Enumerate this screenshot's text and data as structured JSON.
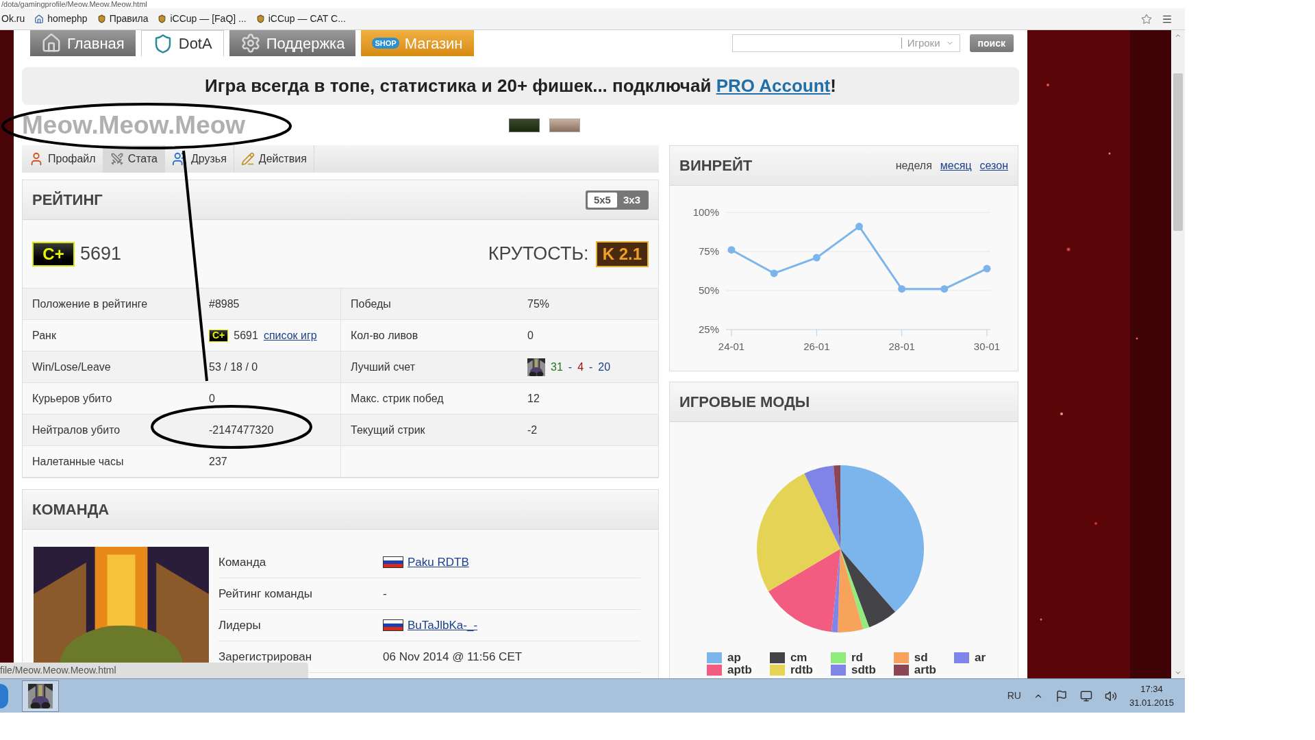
{
  "address_bar": {
    "url": "/dota/gamingprofile/Meow.Meow.Meow.html"
  },
  "bookmarks": [
    {
      "label": "Ok.ru",
      "kind": "ok"
    },
    {
      "label": "homephp",
      "kind": "home"
    },
    {
      "label": "Правила",
      "kind": "shield"
    },
    {
      "label": "iCCup — [FaQ] ...",
      "kind": "shield"
    },
    {
      "label": "iCCup — CAT C...",
      "kind": "shield"
    }
  ],
  "nav": {
    "tabs": [
      {
        "label": "Главная",
        "selected": false,
        "kind": "home"
      },
      {
        "label": "DotA",
        "selected": true,
        "kind": "dota"
      },
      {
        "label": "Поддержка",
        "selected": false,
        "kind": "support"
      },
      {
        "label": "Магазин",
        "selected": false,
        "kind": "shop",
        "badge": "SHOP"
      }
    ],
    "search": {
      "scope": "Игроки",
      "button": "поиск"
    }
  },
  "promo": {
    "before": "Игра всегда в топе, статистика и 20+ фишек... подключай ",
    "link": "PRO Account",
    "after": "!"
  },
  "profile": {
    "name": "Meow.Meow.Meow",
    "tabs": [
      {
        "label": "Профайл",
        "selected": false,
        "kind": "profile"
      },
      {
        "label": "Стата",
        "selected": true,
        "kind": "stats"
      },
      {
        "label": "Друзья",
        "selected": false,
        "kind": "friends"
      },
      {
        "label": "Действия",
        "selected": false,
        "kind": "actions"
      }
    ]
  },
  "rating": {
    "title": "РЕЙТИНГ",
    "modes": [
      {
        "label": "5x5",
        "selected": true
      },
      {
        "label": "3x3",
        "selected": false
      }
    ],
    "badge": "C+",
    "points": "5691",
    "coolness_label": "КРУТОСТЬ:",
    "coolness": "K 2.1",
    "rows": [
      {
        "left": {
          "kind": "text",
          "label": "Положение в рейтинге",
          "value": "#8985"
        },
        "right": {
          "kind": "text",
          "label": "Победы",
          "value": "75%"
        }
      },
      {
        "left": {
          "kind": "rank",
          "label": "Ранк",
          "badge": "C+",
          "value": "5691",
          "link": "список игр"
        },
        "right": {
          "kind": "text",
          "label": "Кол-во ливов",
          "value": "0"
        }
      },
      {
        "left": {
          "kind": "text",
          "label": "Win/Lose/Leave",
          "value": "53 / 18 / 0"
        },
        "right": {
          "kind": "score",
          "label": "Лучший счет",
          "kills": "31",
          "separator": "-",
          "deaths": "4",
          "assists": "20"
        }
      },
      {
        "left": {
          "kind": "text",
          "label": "Курьеров убито",
          "value": "0"
        },
        "right": {
          "kind": "text",
          "label": "Макс. стрик побед",
          "value": "12"
        }
      },
      {
        "left": {
          "kind": "text",
          "label": "Нейтралов убито",
          "value": "-2147477320"
        },
        "right": {
          "kind": "text",
          "label": "Текущий стрик",
          "value": "-2"
        }
      },
      {
        "left": {
          "kind": "text",
          "label": "Налетанные часы",
          "value": "237"
        }
      }
    ]
  },
  "team": {
    "title": "КОМАНДА",
    "rows": [
      {
        "kind": "link",
        "label": "Команда",
        "value": "Paku RDTB"
      },
      {
        "kind": "text",
        "label": "Рейтинг команды",
        "value": "-"
      },
      {
        "kind": "link",
        "label": "Лидеры",
        "value": "BuTaJlbKa-_-"
      },
      {
        "kind": "text",
        "label": "Зарегистрирован",
        "value": "06 Nov 2014 @ 11:56 CET"
      }
    ]
  },
  "winrate": {
    "title": "ВИНРЕЙТ",
    "periods": [
      {
        "label": "неделя",
        "selected": true
      },
      {
        "label": "месяц",
        "selected": false
      },
      {
        "label": "сезон",
        "selected": false
      }
    ],
    "chart_data": {
      "type": "line",
      "categories": [
        "24-01",
        null,
        "26-01",
        null,
        "28-01",
        null,
        "30-01"
      ],
      "series": [
        {
          "color": "#7cb5ec",
          "marker": true,
          "values": [
            76,
            61,
            71,
            91,
            51,
            51,
            64
          ]
        }
      ],
      "ylim": [
        25,
        100
      ],
      "yticks": [
        {
          "value": 25,
          "label": "25%"
        },
        {
          "value": 50,
          "label": "50%"
        },
        {
          "value": 75,
          "label": "75%"
        },
        {
          "value": 100,
          "label": "100%"
        }
      ]
    }
  },
  "modes": {
    "title": "ИГРОВЫЕ МОДЫ",
    "chart_data": {
      "type": "pie",
      "categories": [
        "ap",
        "cm",
        "rd",
        "sd",
        "ar",
        "aptb",
        "rdtb",
        "sdtb",
        "artb"
      ],
      "values": [
        38.6,
        5.8,
        1.2,
        4.9,
        1.2,
        14.8,
        26.4,
        5.8,
        1.3
      ],
      "colors": [
        "#7cb5ec",
        "#434348",
        "#90ed7d",
        "#f7a35c",
        "#8085e9",
        "#f15c80",
        "#e4d354",
        "#7f84e6",
        "#8d4653"
      ],
      "legend": true
    }
  },
  "status_bar": {
    "url": "file/Meow.Meow.Meow.html"
  },
  "taskbar": {
    "language": "RU",
    "time": "17:34",
    "date": "31.01.2015"
  }
}
